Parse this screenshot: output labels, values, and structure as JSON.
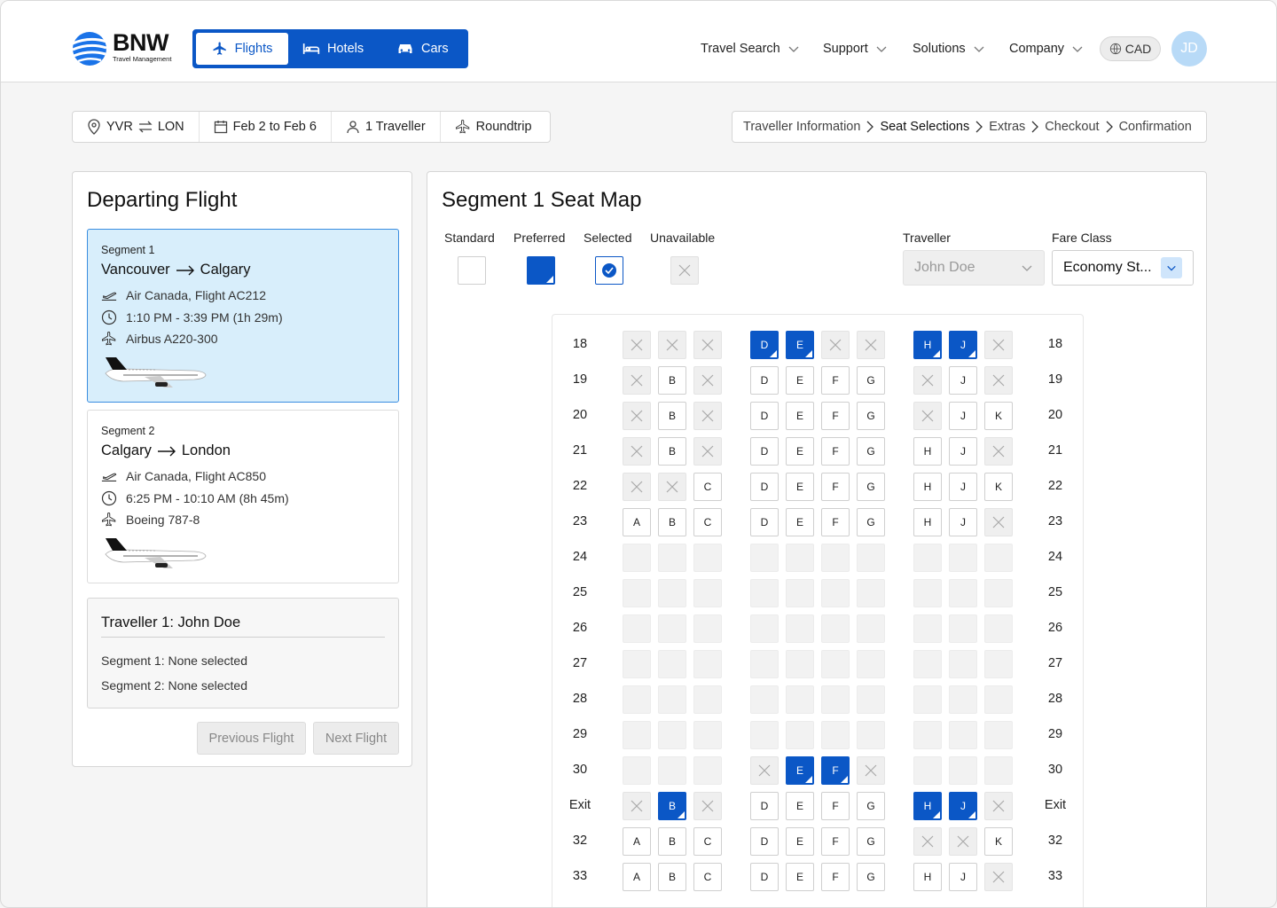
{
  "brand": {
    "name": "BNW",
    "tagline": "Travel Management"
  },
  "modes": [
    {
      "label": "Flights",
      "icon": "airplane-icon"
    },
    {
      "label": "Hotels",
      "icon": "bed-icon"
    },
    {
      "label": "Cars",
      "icon": "car-icon"
    }
  ],
  "nav": [
    {
      "label": "Travel Search"
    },
    {
      "label": "Support"
    },
    {
      "label": "Solutions"
    },
    {
      "label": "Company"
    }
  ],
  "currency": "CAD",
  "user_initials": "JD",
  "summary": {
    "origin": "YVR",
    "destination": "LON",
    "dates": "Feb 2 to Feb 6",
    "travellers": "1 Traveller",
    "trip_type": "Roundtrip"
  },
  "steps": [
    {
      "label": "Traveller Information",
      "current": false
    },
    {
      "label": "Seat Selections",
      "current": true
    },
    {
      "label": "Extras",
      "current": false
    },
    {
      "label": "Checkout",
      "current": false
    },
    {
      "label": "Confirmation",
      "current": false
    }
  ],
  "left": {
    "title": "Departing Flight",
    "segments": [
      {
        "label": "Segment 1",
        "from": "Vancouver",
        "to": "Calgary",
        "flight": "Air Canada, Flight AC212",
        "time": "1:10 PM - 3:39 PM (1h 29m)",
        "aircraft": "Airbus A220-300"
      },
      {
        "label": "Segment 2",
        "from": "Calgary",
        "to": "London",
        "flight": "Air Canada, Flight AC850",
        "time": "6:25 PM - 10:10 AM (8h 45m)",
        "aircraft": "Boeing 787-8"
      }
    ],
    "traveller": {
      "title": "Traveller 1: John Doe",
      "lines": [
        "Segment 1: None selected",
        "Segment 2: None selected"
      ]
    },
    "prev_label": "Previous Flight",
    "next_label": "Next Flight"
  },
  "right": {
    "title": "Segment 1 Seat Map",
    "legend": [
      "Standard",
      "Preferred",
      "Selected",
      "Unavailable"
    ],
    "traveller_label": "Traveller",
    "traveller_value": "John Doe",
    "fare_label": "Fare Class",
    "fare_value": "Economy St..."
  },
  "seatmap": {
    "columns": [
      "A",
      "B",
      "C",
      "D",
      "E",
      "F",
      "G",
      "H",
      "J",
      "K"
    ],
    "legend_codes": "S=standard P=preferred X=unavailable E=empty",
    "rows": [
      {
        "label": "18",
        "seats": "XXX|PPXX|PPX"
      },
      {
        "label": "19",
        "seats": "XSX|SSSS|XSX"
      },
      {
        "label": "20",
        "seats": "XSX|SSSS|XSS"
      },
      {
        "label": "21",
        "seats": "XSX|SSSS|SSX"
      },
      {
        "label": "22",
        "seats": "XXS|SSSS|SSS"
      },
      {
        "label": "23",
        "seats": "SSS|SSSS|SSX"
      },
      {
        "label": "24",
        "seats": "EEE|EEEE|EEE"
      },
      {
        "label": "25",
        "seats": "EEE|EEEE|EEE"
      },
      {
        "label": "26",
        "seats": "EEE|EEEE|EEE"
      },
      {
        "label": "27",
        "seats": "EEE|EEEE|EEE"
      },
      {
        "label": "28",
        "seats": "EEE|EEEE|EEE"
      },
      {
        "label": "29",
        "seats": "EEE|EEEE|EEE"
      },
      {
        "label": "30",
        "seats": "EEE|XPPX|EEE"
      },
      {
        "label": "Exit",
        "seats": "XPX|SSSS|PPX"
      },
      {
        "label": "32",
        "seats": "SSS|SSSS|XXS"
      },
      {
        "label": "33",
        "seats": "SSS|SSSS|SSX"
      }
    ]
  }
}
